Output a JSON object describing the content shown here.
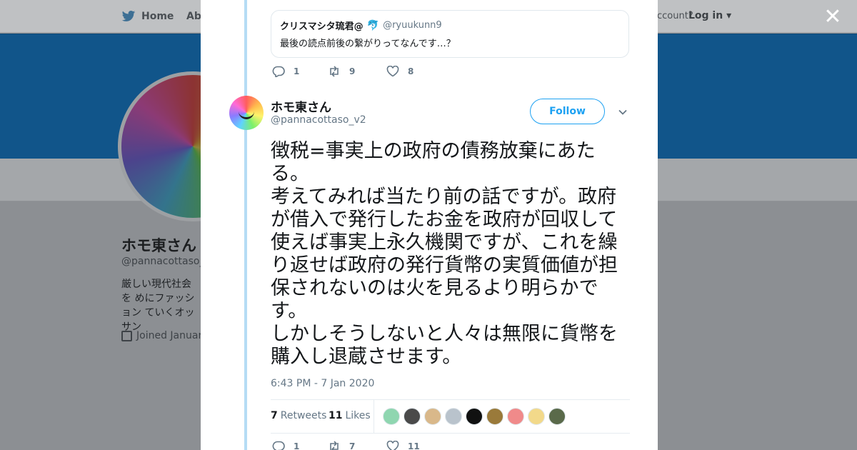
{
  "background": {
    "nav": {
      "home_label": "Home",
      "about_label": "Abo",
      "account_text": "ccount?",
      "login_label": "Log in"
    },
    "profile": {
      "name": "ホモ東さん",
      "handle": "@pannacottaso_v",
      "bio": "厳しい現代社会を めにファッション ていくオッサン",
      "joined": "Joined Januar"
    },
    "colors": {
      "banner": "#11558a",
      "overlay": "#8c8f93"
    }
  },
  "modal": {
    "close_icon": "close-x",
    "quoted": {
      "name": "クリスマシタ琉君@",
      "emoji": "🐬",
      "handle": "@ryuukunn9",
      "text": "最後の読点前後の繋がりってなんです…？"
    },
    "top_actions": {
      "replies": "1",
      "retweets": "9",
      "likes": "8"
    },
    "tweet": {
      "author_name": "ホモ東さん",
      "author_handle": "@pannacottaso_v2",
      "follow_label": "Follow",
      "text": "徴税=事実上の政府の債務放棄にあたる。\n考えてみれば当たり前の話ですが。政府が借入で発行したお金を政府が回収して使えば事実上永久機関ですが、これを繰り返せば政府の発行貨幣の実質価値が担保されないのは火を見るより明らかです。\nしかしそうしないと人々は無限に貨幣を購入し退蔵させます。",
      "timestamp": "6:43 PM - 7 Jan 2020",
      "retweet_count": "7",
      "retweets_label": "Retweets",
      "like_count": "11",
      "likes_label": "Likes",
      "liker_avatars": [
        "#8fd6b0",
        "#4a4a4a",
        "#d9b88a",
        "#b9c3cc",
        "#111111",
        "#9a7a3a",
        "#f08a8a",
        "#f2d98a",
        "#5a6a4a"
      ]
    },
    "bottom_actions": {
      "replies": "1",
      "retweets": "7",
      "likes": "11"
    },
    "colors": {
      "accent": "#1da1f2",
      "thread_line": "#b5dcf5",
      "muted": "#657786"
    }
  }
}
